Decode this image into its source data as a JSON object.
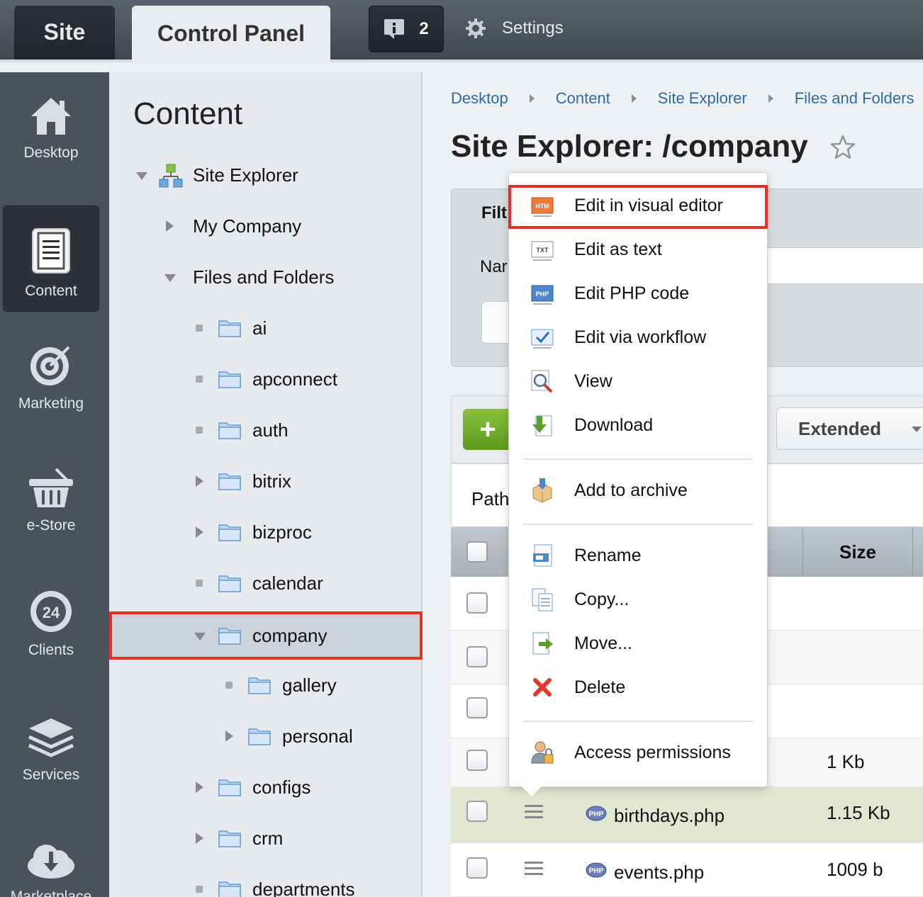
{
  "topbar": {
    "site_tab": "Site",
    "control_panel_tab": "Control Panel",
    "notifications_count": "2",
    "settings_label": "Settings"
  },
  "leftbar": {
    "items": [
      {
        "label": "Desktop",
        "icon": "home-icon"
      },
      {
        "label": "Content",
        "icon": "document-icon",
        "active": true
      },
      {
        "label": "Marketing",
        "icon": "target-icon"
      },
      {
        "label": "e-Store",
        "icon": "basket-icon"
      },
      {
        "label": "Clients",
        "icon": "clients-24-icon"
      },
      {
        "label": "Services",
        "icon": "layers-icon"
      },
      {
        "label": "Marketplace",
        "icon": "cloud-download-icon"
      }
    ]
  },
  "tree": {
    "title": "Content",
    "items": [
      {
        "label": "Site Explorer"
      },
      {
        "label": "My Company"
      },
      {
        "label": "Files and Folders"
      },
      {
        "label": "ai"
      },
      {
        "label": "apconnect"
      },
      {
        "label": "auth"
      },
      {
        "label": "bitrix"
      },
      {
        "label": "bizproc"
      },
      {
        "label": "calendar"
      },
      {
        "label": "company",
        "selected": true
      },
      {
        "label": "gallery"
      },
      {
        "label": "personal"
      },
      {
        "label": "configs"
      },
      {
        "label": "crm"
      },
      {
        "label": "departments"
      }
    ]
  },
  "breadcrumb": [
    "Desktop",
    "Content",
    "Site Explorer",
    "Files and Folders"
  ],
  "page_title": "Site Explorer: /company",
  "filter": {
    "title": "Filt",
    "name_label": "Nar"
  },
  "toolbar": {
    "add_label": "+",
    "extended_label": "Extended"
  },
  "path_label": "Path",
  "table": {
    "size_header": "Size",
    "rows": [
      {
        "name": "",
        "size": ""
      },
      {
        "name": "",
        "size": ""
      },
      {
        "name": "",
        "size": ""
      },
      {
        "name": "",
        "size": "1 Kb"
      },
      {
        "name": "birthdays.php",
        "size": "1.15 Kb"
      },
      {
        "name": "events.php",
        "size": "1009 b"
      }
    ]
  },
  "context_menu": {
    "items": [
      {
        "label": "Edit in visual editor",
        "icon": "html-edit-icon"
      },
      {
        "label": "Edit as text",
        "icon": "txt-edit-icon"
      },
      {
        "label": "Edit PHP code",
        "icon": "php-edit-icon"
      },
      {
        "label": "Edit via workflow",
        "icon": "workflow-icon"
      },
      {
        "label": "View",
        "icon": "magnifier-icon"
      },
      {
        "label": "Download",
        "icon": "download-icon"
      },
      {
        "label": "Add to archive",
        "icon": "archive-icon"
      },
      {
        "label": "Rename",
        "icon": "rename-icon"
      },
      {
        "label": "Copy...",
        "icon": "copy-icon"
      },
      {
        "label": "Move...",
        "icon": "move-icon"
      },
      {
        "label": "Delete",
        "icon": "delete-icon"
      },
      {
        "label": "Access permissions",
        "icon": "permissions-icon"
      }
    ]
  },
  "colors": {
    "highlight_border": "#e53028",
    "link": "#2f6aa4",
    "add_button": "#6fab2a"
  }
}
